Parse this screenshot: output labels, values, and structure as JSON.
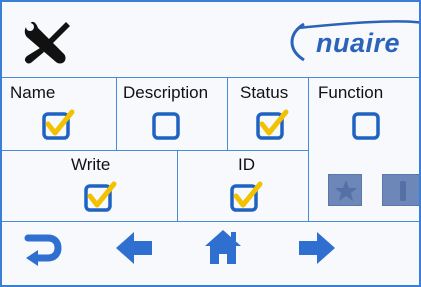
{
  "header": {
    "settings_icon": "tools-icon",
    "logo_text": "nuaire"
  },
  "fields_row1": {
    "columns": [
      {
        "label": "Name",
        "checked": true
      },
      {
        "label": "Description",
        "checked": false
      },
      {
        "label": "Status",
        "checked": true
      },
      {
        "label": "Function",
        "checked": false
      }
    ]
  },
  "fields_row2": {
    "columns": [
      {
        "label": "Write",
        "checked": true
      },
      {
        "label": "ID",
        "checked": true
      }
    ]
  },
  "side_buttons": [
    "star-icon",
    "info-icon"
  ],
  "nav": {
    "buttons": [
      "return-icon",
      "back-arrow-icon",
      "home-icon",
      "forward-arrow-icon"
    ]
  },
  "colors": {
    "accent_blue": "#3a7fd3",
    "check_yellow": "#f2c200",
    "box_blue": "#1f63c2",
    "logo_blue": "#2a63b8"
  }
}
